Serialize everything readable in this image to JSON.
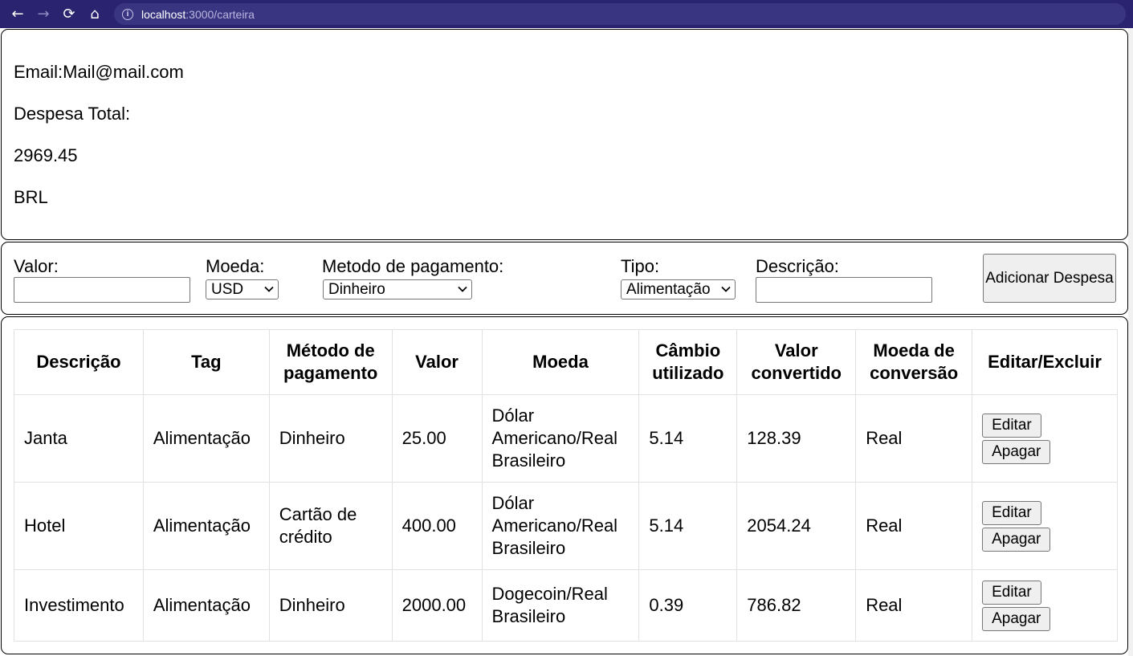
{
  "browser": {
    "url_host": "localhost",
    "url_path": ":3000/carteira"
  },
  "header": {
    "email": "Email:Mail@mail.com",
    "total_label": "Despesa Total:",
    "total_value": "2969.45",
    "currency": "BRL"
  },
  "form": {
    "valor_label": "Valor:",
    "valor_value": "",
    "moeda_label": "Moeda:",
    "moeda_selected": "USD",
    "metodo_label": "Metodo de pagamento:",
    "metodo_selected": "Dinheiro",
    "tipo_label": "Tipo:",
    "tipo_selected": "Alimentação",
    "descricao_label": "Descrição:",
    "descricao_value": "",
    "add_button": "Adicionar Despesa"
  },
  "table": {
    "headers": [
      "Descrição",
      "Tag",
      "Método de pagamento",
      "Valor",
      "Moeda",
      "Câmbio utilizado",
      "Valor convertido",
      "Moeda de conversão",
      "Editar/Excluir"
    ],
    "rows": [
      {
        "descricao": "Janta",
        "tag": "Alimentação",
        "metodo": "Dinheiro",
        "valor": "25.00",
        "moeda": "Dólar Americano/Real Brasileiro",
        "cambio": "5.14",
        "convertido": "128.39",
        "conversao": "Real",
        "edit": "Editar",
        "delete": "Apagar"
      },
      {
        "descricao": "Hotel",
        "tag": "Alimentação",
        "metodo": "Cartão de crédito",
        "valor": "400.00",
        "moeda": "Dólar Americano/Real Brasileiro",
        "cambio": "5.14",
        "convertido": "2054.24",
        "conversao": "Real",
        "edit": "Editar",
        "delete": "Apagar"
      },
      {
        "descricao": "Investimento",
        "tag": "Alimentação",
        "metodo": "Dinheiro",
        "valor": "2000.00",
        "moeda": "Dogecoin/Real Brasileiro",
        "cambio": "0.39",
        "convertido": "786.82",
        "conversao": "Real",
        "edit": "Editar",
        "delete": "Apagar"
      }
    ]
  }
}
